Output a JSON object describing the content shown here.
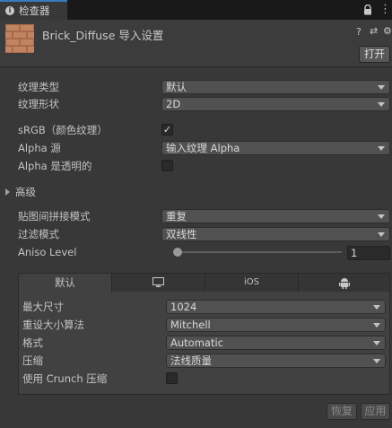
{
  "tab": {
    "label": "检查器",
    "icon": "info-icon"
  },
  "header": {
    "title": "Brick_Diffuse 导入设置",
    "open_label": "打开"
  },
  "texture_type": {
    "label": "纹理类型",
    "value": "默认"
  },
  "texture_shape": {
    "label": "纹理形状",
    "value": "2D"
  },
  "srgb": {
    "label": "sRGB（颜色纹理）",
    "checked": true
  },
  "alpha_source": {
    "label": "Alpha 源",
    "value": "输入纹理 Alpha"
  },
  "alpha_transparency": {
    "label": "Alpha 是透明的",
    "checked": false
  },
  "advanced": {
    "label": "高级"
  },
  "wrap_mode": {
    "label": "贴图间拼接模式",
    "value": "重复"
  },
  "filter_mode": {
    "label": "过滤模式",
    "value": "双线性"
  },
  "aniso": {
    "label": "Aniso Level",
    "value": "1"
  },
  "platform_tabs": {
    "default": "默认",
    "ios": "iOS"
  },
  "platform": {
    "max_size": {
      "label": "最大尺寸",
      "value": "1024"
    },
    "resize": {
      "label": "重设大小算法",
      "value": "Mitchell"
    },
    "format": {
      "label": "格式",
      "value": "Automatic"
    },
    "compression": {
      "label": "压缩",
      "value": "法线质量"
    },
    "crunch": {
      "label": "使用 Crunch 压缩",
      "checked": false
    }
  },
  "buttons": {
    "revert": "恢复",
    "apply": "应用"
  }
}
